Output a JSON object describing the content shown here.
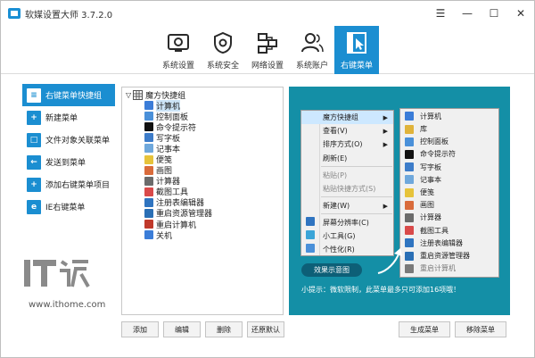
{
  "window": {
    "title": "软媒设置大师 3.7.2.0",
    "menu_icon": "☰",
    "minimize": "—",
    "maximize": "☐",
    "close": "✕"
  },
  "toolbar": {
    "tabs": [
      {
        "label": "系统设置",
        "icon": "system-settings-icon"
      },
      {
        "label": "系统安全",
        "icon": "shield-gear-icon"
      },
      {
        "label": "网络设置",
        "icon": "network-icon"
      },
      {
        "label": "系统账户",
        "icon": "users-icon"
      },
      {
        "label": "右键菜单",
        "icon": "cursor-panel-icon",
        "active": true
      }
    ]
  },
  "leftnav": {
    "items": [
      {
        "label": "右键菜单快捷组",
        "icon": "≡",
        "active": true
      },
      {
        "label": "新建菜单",
        "icon": "+"
      },
      {
        "label": "文件对象关联菜单",
        "icon": "□"
      },
      {
        "label": "发送到菜单",
        "icon": "←"
      },
      {
        "label": "添加右键菜单项目",
        "icon": "+"
      },
      {
        "label": "IE右键菜单",
        "icon": "e"
      }
    ]
  },
  "tree": {
    "expander": "▽",
    "root": "魔方快捷组",
    "items": [
      {
        "label": "计算机",
        "color": "#3b7dd8",
        "selected": true
      },
      {
        "label": "控制面板",
        "color": "#4a90d9"
      },
      {
        "label": "命令提示符",
        "color": "#111111"
      },
      {
        "label": "写字板",
        "color": "#3d7cc9"
      },
      {
        "label": "记事本",
        "color": "#6fa8dc"
      },
      {
        "label": "便笺",
        "color": "#e6c33b"
      },
      {
        "label": "画图",
        "color": "#d96b3b"
      },
      {
        "label": "计算器",
        "color": "#6b6b6b"
      },
      {
        "label": "截图工具",
        "color": "#d94a4a"
      },
      {
        "label": "注册表编辑器",
        "color": "#2f74c0"
      },
      {
        "label": "重启资源管理器",
        "color": "#2a6fb5"
      },
      {
        "label": "重启计算机",
        "color": "#c0392b"
      },
      {
        "label": "关机",
        "color": "#3b7dd8"
      }
    ]
  },
  "preview": {
    "menu": [
      {
        "label": "魔方快捷组",
        "arrow": "▶",
        "highlight": true
      },
      {
        "label": "查看(V)",
        "arrow": "▶"
      },
      {
        "label": "排序方式(O)",
        "arrow": "▶"
      },
      {
        "label": "刷新(E)"
      },
      {
        "label": "粘贴(P)",
        "disabled": true
      },
      {
        "label": "粘贴快捷方式(S)",
        "disabled": true
      },
      {
        "label": "新建(W)",
        "arrow": "▶"
      },
      {
        "label": "屏幕分辨率(C)"
      },
      {
        "label": "小工具(G)"
      },
      {
        "label": "个性化(R)"
      }
    ],
    "submenu": [
      {
        "label": "计算机",
        "color": "#3b7dd8"
      },
      {
        "label": "库",
        "color": "#e0b33a"
      },
      {
        "label": "控制面板",
        "color": "#4a90d9"
      },
      {
        "label": "命令提示符",
        "color": "#111111"
      },
      {
        "label": "写字板",
        "color": "#3d7cc9"
      },
      {
        "label": "记事本",
        "color": "#6fa8dc"
      },
      {
        "label": "便笺",
        "color": "#e6c33b"
      },
      {
        "label": "画图",
        "color": "#d96b3b"
      },
      {
        "label": "计算器",
        "color": "#6b6b6b"
      },
      {
        "label": "截图工具",
        "color": "#d94a4a"
      },
      {
        "label": "注册表编辑器",
        "color": "#2f74c0"
      },
      {
        "label": "重启资源管理器",
        "color": "#2a6fb5"
      },
      {
        "label": "重启计算机",
        "color": "#7a7a7a",
        "disabled": true
      }
    ],
    "effect_button": "效果示意图",
    "tip": "小提示：微软限制，此菜单最多只可添加16项哦！"
  },
  "buttons": {
    "add": "添加",
    "edit": "编辑",
    "delete": "删除",
    "restore_default": "还原默认",
    "generate_menu": "生成菜单",
    "remove_menu": "移除菜单"
  },
  "watermark": {
    "url": "www.ithome.com"
  },
  "colors": {
    "accent": "#1b8ed1",
    "preview_bg": "#148fa6",
    "effect_button": "#0d5f77"
  }
}
